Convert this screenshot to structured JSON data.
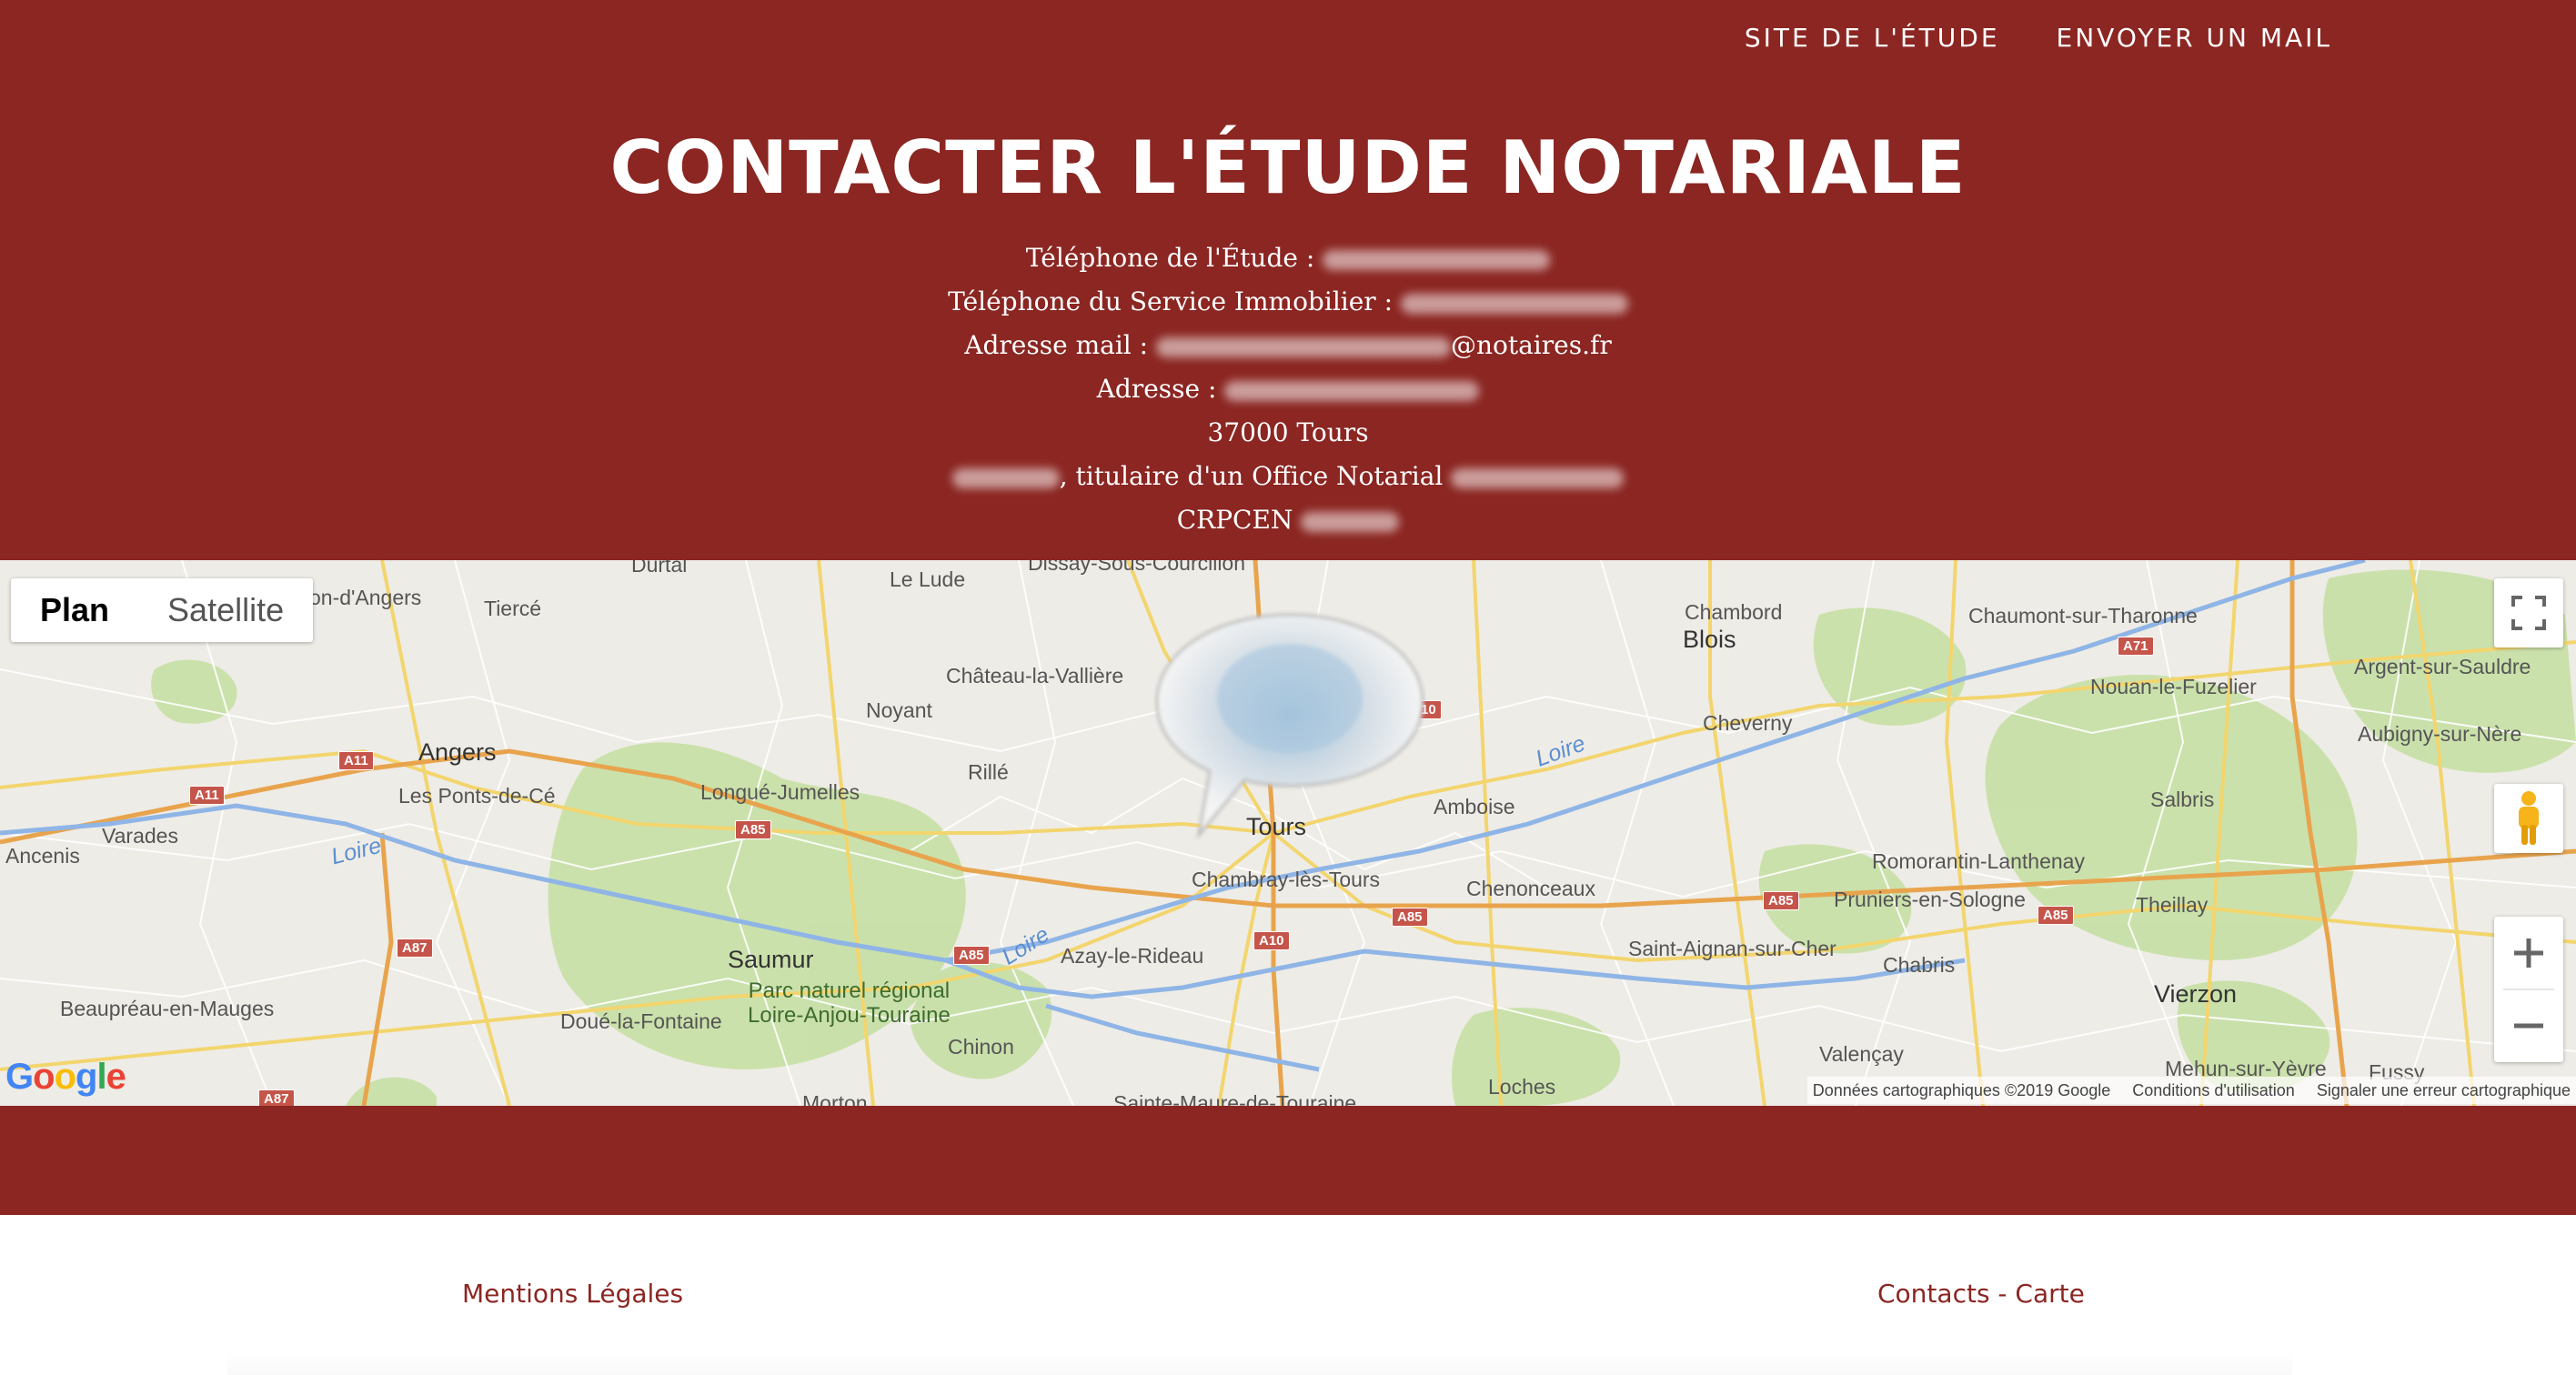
{
  "nav": {
    "site_link": "SITE DE L'ÉTUDE",
    "mail_link": "ENVOYER UN MAIL"
  },
  "header": {
    "title": "CONTACTER L'ÉTUDE NOTARIALE",
    "phone_label": "Téléphone de l'Étude :",
    "realestate_label": "Téléphone du Service Immobilier :",
    "email_label": "Adresse mail :",
    "email_domain": "@notaires.fr",
    "address_label": "Adresse :",
    "city_line": "37000 Tours",
    "titulaire_text": ", titulaire d'un Office Notarial",
    "crpcen_label": "CRPCEN"
  },
  "map": {
    "type_plan": "Plan",
    "type_satellite": "Satellite",
    "google_logo": "Google",
    "attribution": {
      "data": "Données cartographiques ©2019 Google",
      "terms": "Conditions d'utilisation",
      "report": "Signaler une erreur cartographique"
    },
    "icons": {
      "fullscreen": "fullscreen-icon",
      "pegman": "pegman-icon",
      "zoom_in": "plus-icon",
      "zoom_out": "minus-icon",
      "marker": "info-bubble-icon"
    },
    "places": {
      "angers": "Angers",
      "tours": "Tours",
      "blois": "Blois",
      "saumur": "Saumur",
      "chinon": "Chinon",
      "amboise": "Amboise",
      "vierzon": "Vierzon",
      "chambord": "Chambord",
      "cheverny": "Cheverny",
      "chambray": "Chambray-lès-Tours",
      "chenonceaux": "Chenonceaux",
      "azay": "Azay-le-Rideau",
      "loches": "Loches",
      "valencay": "Valençay",
      "chabris": "Chabris",
      "salbris": "Salbris",
      "theillay": "Theillay",
      "romorantin": "Romorantin-Lanthenay",
      "pruniers": "Pruniers-en-Sologne",
      "saint_aignan": "Saint-Aignan-sur-Cher",
      "nouan": "Nouan-le-Fuzelier",
      "aubigny": "Aubigny-sur-Nère",
      "argent": "Argent-sur-Sauldre",
      "chaumont": "Chaumont-sur-Tharonne",
      "mehun": "Mehun-sur-Yèvre",
      "fussy": "Fussy",
      "chateau_la_valliere": "Château-la-Vallière",
      "noyant": "Noyant",
      "rille": "Rillé",
      "le_lude": "Le Lude",
      "dissay": "Dissay-Sous-Courcillon",
      "longue": "Longué-Jumelles",
      "ponts_de_ce": "Les Ponts-de-Cé",
      "varades": "Varades",
      "ancenis": "Ancenis",
      "beaupreau": "Beaupréau-en-Mauges",
      "doue": "Doué-la-Fontaine",
      "tierce": "Tiercé",
      "on_angers": "on-d'Angers",
      "durtal": "Durtal",
      "morton": "Morton",
      "sainte_maure": "Sainte-Maure-de-Touraine",
      "park_line1": "Parc naturel régional",
      "park_line2": "Loire-Anjou-Touraine"
    },
    "rivers": {
      "loire": "Loire"
    },
    "roads": {
      "a11": "A11",
      "a85": "A85",
      "a87": "A87",
      "a10": "A10",
      "a71": "A71",
      "a10_partial": "10"
    }
  },
  "footer": {
    "legal_link": "Mentions Légales",
    "contact_link": "Contacts - Carte"
  },
  "colors": {
    "brand": "#8b2622",
    "white": "#ffffff",
    "map_land": "#eeece6",
    "park_green": "#c8e0a8",
    "road_yellow": "#f3d56e",
    "river_blue": "#8fb5e6"
  }
}
